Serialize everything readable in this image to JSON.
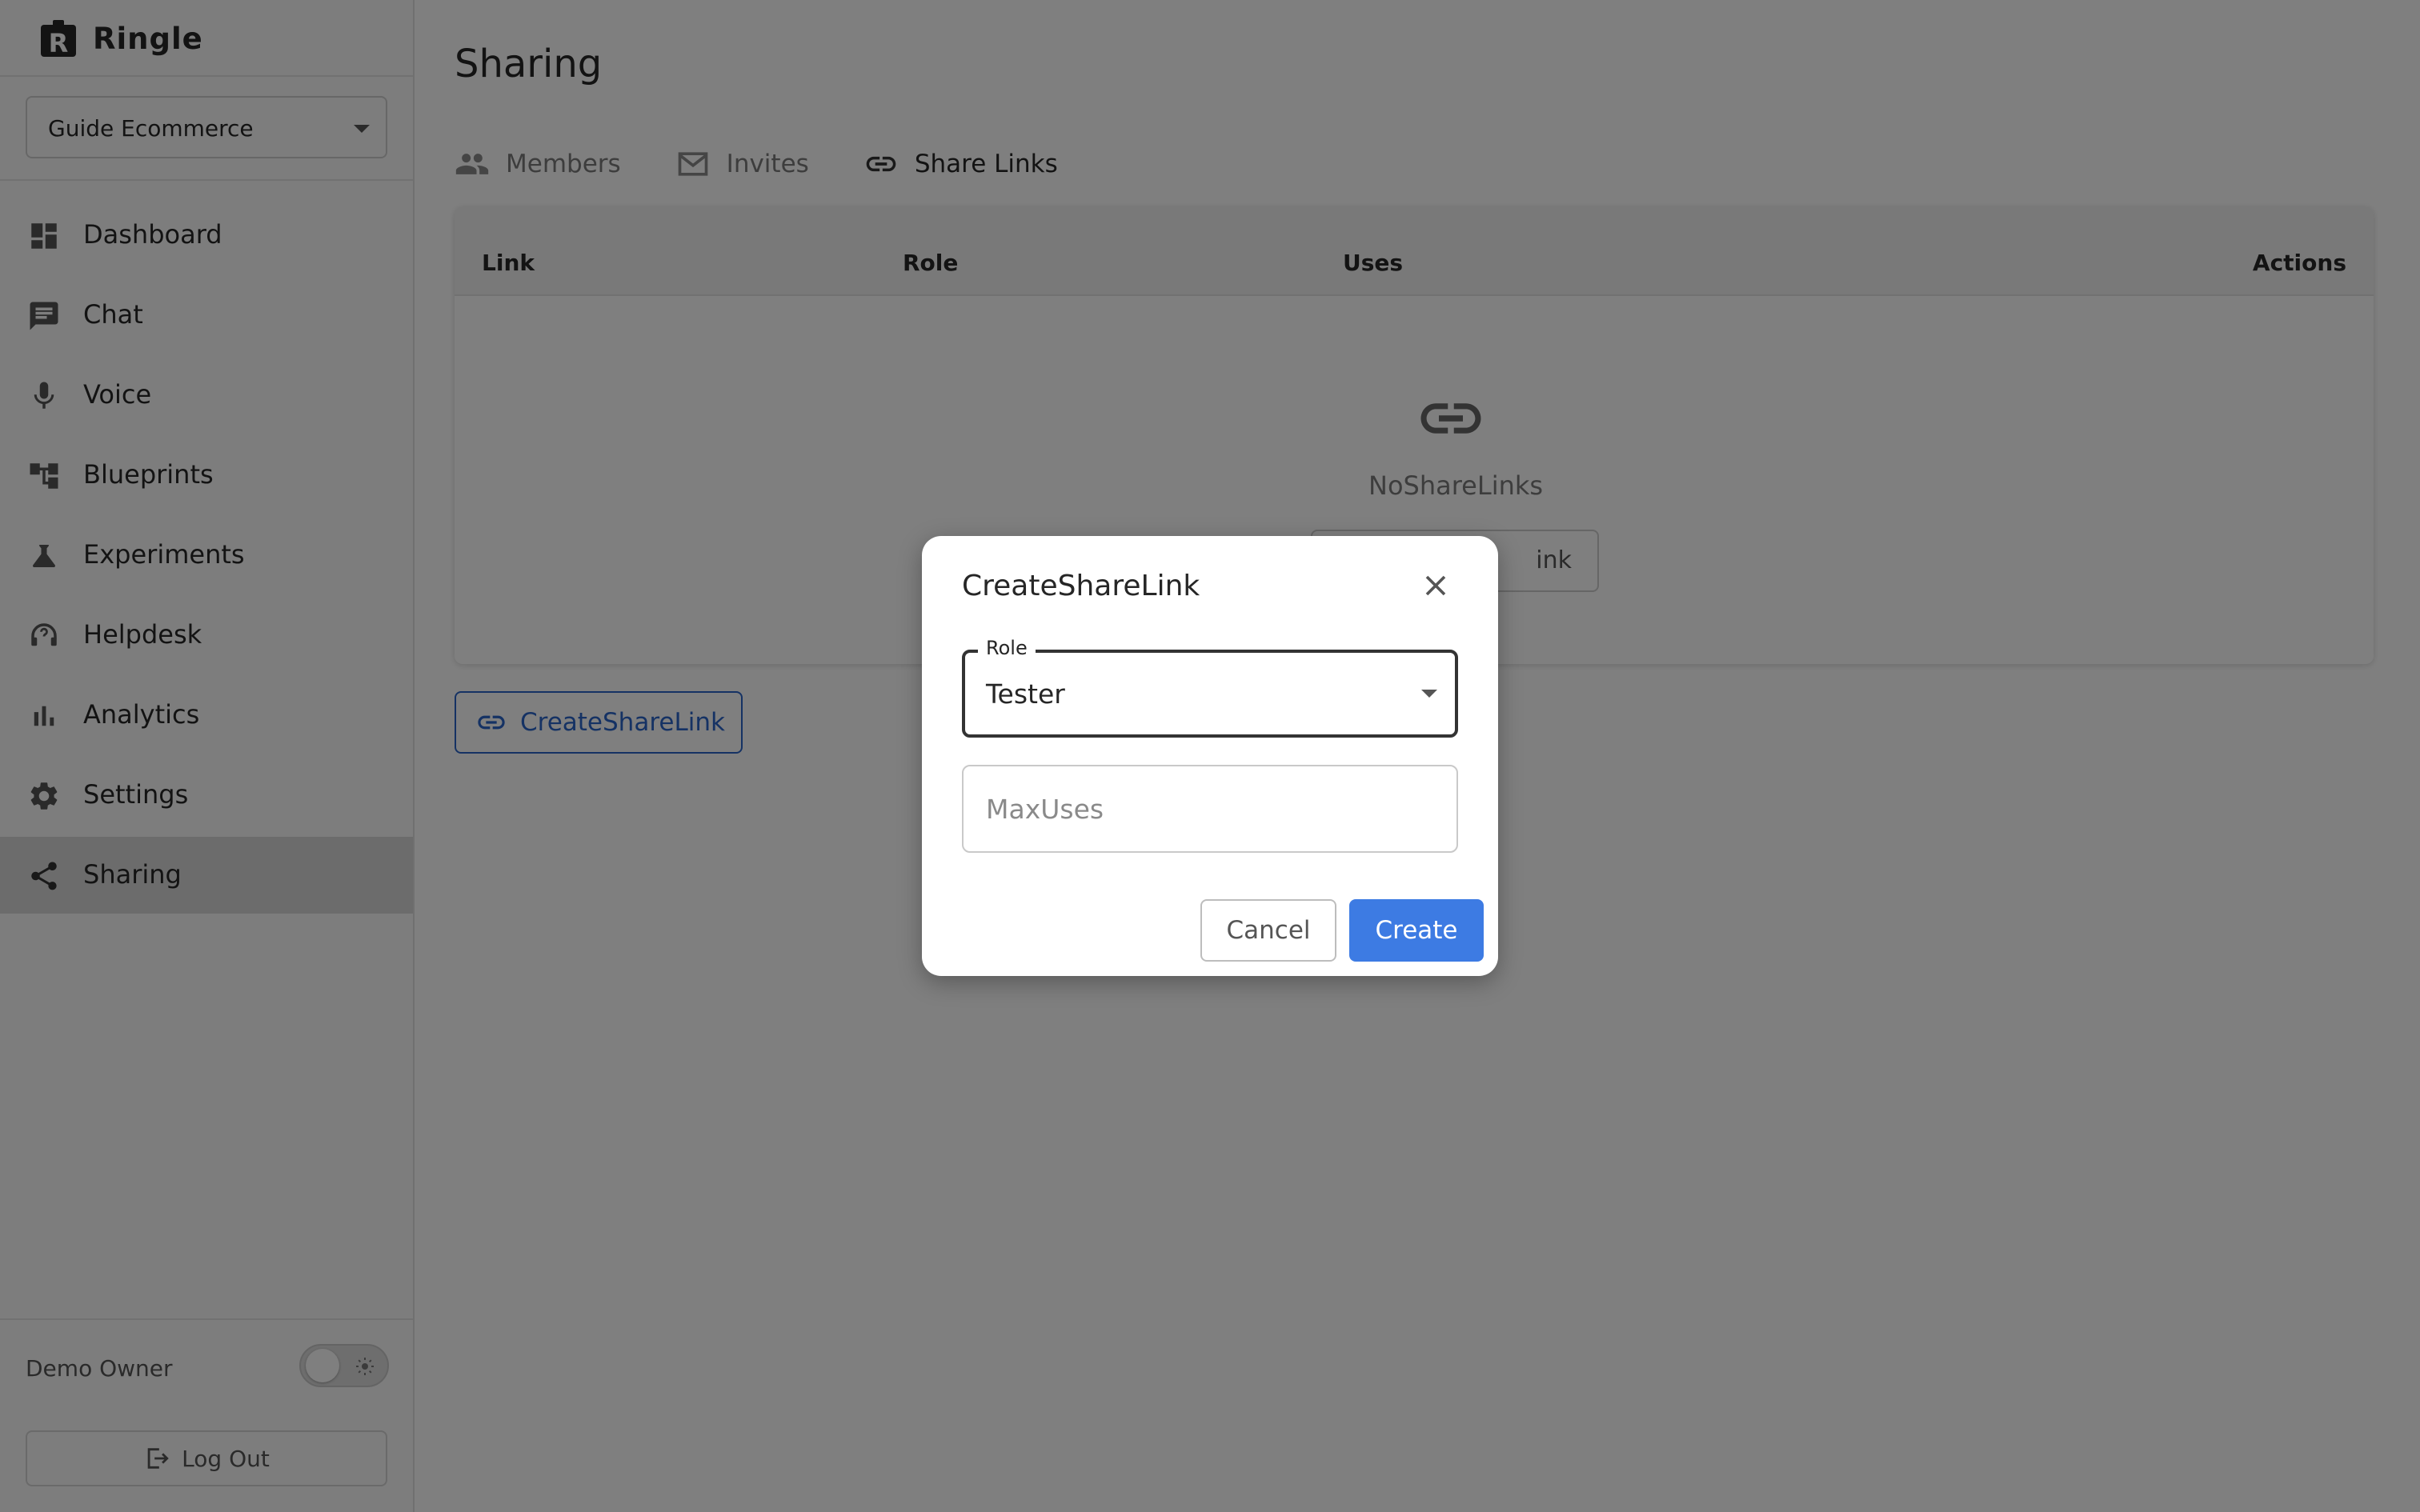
{
  "app": {
    "name": "Ringle"
  },
  "sidebar": {
    "project": "Guide Ecommerce",
    "items": [
      {
        "label": "Dashboard",
        "icon": "dashboard-icon"
      },
      {
        "label": "Chat",
        "icon": "chat-icon"
      },
      {
        "label": "Voice",
        "icon": "microphone-icon"
      },
      {
        "label": "Blueprints",
        "icon": "blueprint-icon"
      },
      {
        "label": "Experiments",
        "icon": "flask-icon"
      },
      {
        "label": "Helpdesk",
        "icon": "headset-icon"
      },
      {
        "label": "Analytics",
        "icon": "bar-chart-icon"
      },
      {
        "label": "Settings",
        "icon": "gear-icon"
      },
      {
        "label": "Sharing",
        "icon": "share-icon",
        "active": true
      }
    ],
    "user": "Demo Owner",
    "logout": "Log Out"
  },
  "page": {
    "title": "Sharing",
    "tabs": [
      {
        "label": "Members",
        "icon": "people-icon"
      },
      {
        "label": "Invites",
        "icon": "mail-icon"
      },
      {
        "label": "Share Links",
        "icon": "link-icon",
        "active": true
      }
    ],
    "table": {
      "columns": [
        "Link",
        "Role",
        "Uses",
        "Actions"
      ],
      "empty_text": "NoShareLinks",
      "empty_button_visible": "ink"
    },
    "create_button": "CreateShareLink"
  },
  "dialog": {
    "title": "CreateShareLink",
    "role_label": "Role",
    "role_value": "Tester",
    "max_uses_placeholder": "MaxUses",
    "cancel": "Cancel",
    "create": "Create"
  },
  "colors": {
    "accent": "#3d7be3",
    "link_text": "#2a64c8",
    "overlay": "rgba(0,0,0,0.5)"
  }
}
